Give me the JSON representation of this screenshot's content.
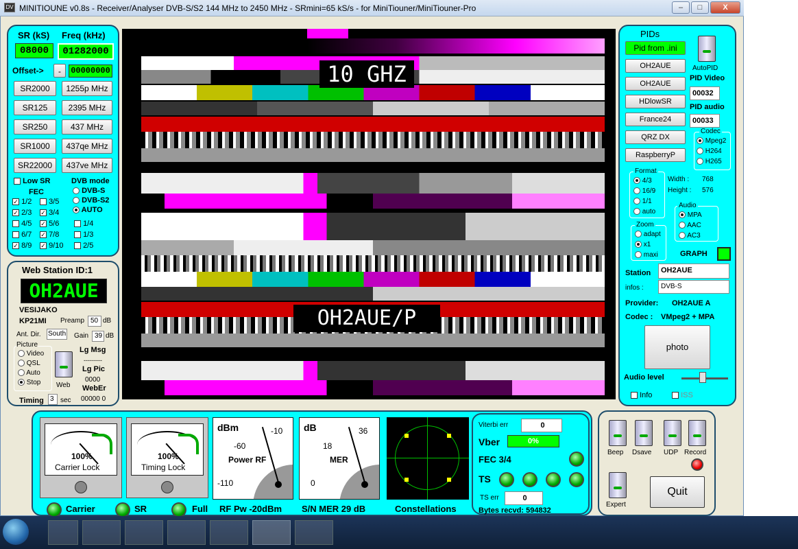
{
  "title": "MINITIOUNE v0.8s - Receiver/Analyser DVB-S/S2 144 MHz to 2450 MHz - SRmini=65 kS/s - for MiniTiouner/MiniTiouner-Pro",
  "colors": {
    "panel": "#00ffff",
    "lcd": "#00ff00",
    "border": "#1e4d6b"
  },
  "left": {
    "sr_label": "SR (kS)",
    "freq_label": "Freq (kHz)",
    "sr": "08000",
    "freq": "01282000",
    "offset_label": "Offset->",
    "offset_sign": "-",
    "offset": "00000000",
    "sr_buttons": [
      "SR2000",
      "SR125",
      "SR250",
      "SR1000",
      "SR22000"
    ],
    "freq_buttons": [
      "1255p MHz",
      "2395 MHz",
      "437 MHz",
      "437qe MHz",
      "437ve MHz"
    ],
    "low_sr": "Low SR",
    "fec_label": "FEC",
    "dvb_label": "DVB mode",
    "dvb_modes": [
      {
        "label": "DVB-S",
        "on": false
      },
      {
        "label": "DVB-S2",
        "on": false
      },
      {
        "label": "AUTO",
        "on": true
      }
    ],
    "fec": [
      [
        {
          "l": "1/2",
          "c": true
        },
        {
          "l": "3/5",
          "c": false
        },
        {
          "l": "",
          "c": null
        }
      ],
      [
        {
          "l": "2/3",
          "c": true
        },
        {
          "l": "3/4",
          "c": true
        },
        {
          "l": "",
          "c": null
        }
      ],
      [
        {
          "l": "4/5",
          "c": false
        },
        {
          "l": "5/6",
          "c": true
        },
        {
          "l": "1/4",
          "c": false
        }
      ],
      [
        {
          "l": "6/7",
          "c": false
        },
        {
          "l": "7/8",
          "c": true
        },
        {
          "l": "1/3",
          "c": false
        }
      ],
      [
        {
          "l": "8/9",
          "c": true
        },
        {
          "l": "9/10",
          "c": true
        },
        {
          "l": "2/5",
          "c": false
        }
      ]
    ]
  },
  "web": {
    "title": "Web Station ID:1",
    "callsign": "OH2AUE",
    "name": "VESIJAKO",
    "locator": "KP21MI",
    "preamp_label": "Preamp",
    "preamp": "50",
    "db": "dB",
    "ant_label": "Ant. Dir.",
    "ant": "South",
    "gain_label": "Gain",
    "gain": "39",
    "picture_label": "Picture",
    "picture_opts": [
      {
        "label": "Video",
        "on": false
      },
      {
        "label": "QSL",
        "on": false
      },
      {
        "label": "Auto",
        "on": false
      },
      {
        "label": "Stop",
        "on": true
      }
    ],
    "web_label": "Web",
    "lgmsg_label": "Lg Msg",
    "lgmsg": "---------",
    "lgpic_label": "Lg Pic",
    "lgpic": "0000",
    "weber_label": "WebEr",
    "weber": "00000  0",
    "timing_label": "Timing",
    "timing": "3",
    "sec": "sec"
  },
  "video": {
    "overlay1": "10 GHZ",
    "overlay2": "OH2AUE/P"
  },
  "right": {
    "pids_label": "PIDs",
    "pid_ini": "Pid from .ini",
    "stations": [
      "OH2AUE",
      "OH2AUE",
      "HDlowSR",
      "France24",
      "QRZ DX",
      "RaspberryP"
    ],
    "autopid_label": "AutoPID",
    "pid_video_label": "PID Video",
    "pid_video": "00032",
    "pid_audio_label": "PID audio",
    "pid_audio": "00033",
    "codec_label": "Codec",
    "codecs": [
      {
        "label": "Mpeg2",
        "on": true
      },
      {
        "label": "H264",
        "on": false
      },
      {
        "label": "H265",
        "on": false
      }
    ],
    "format_label": "Format",
    "formats": [
      {
        "label": "4/3",
        "on": true
      },
      {
        "label": "16/9",
        "on": false
      },
      {
        "label": "1/1",
        "on": false
      },
      {
        "label": "auto",
        "on": false
      }
    ],
    "width_label": "Width :",
    "width": "768",
    "height_label": "Height :",
    "height": "576",
    "audio_label": "Audio",
    "audios": [
      {
        "label": "MPA",
        "on": true
      },
      {
        "label": "AAC",
        "on": false
      },
      {
        "label": "AC3",
        "on": false
      }
    ],
    "zoom_label": "Zoom",
    "zooms": [
      {
        "label": "adapt",
        "on": false
      },
      {
        "label": "x1",
        "on": true
      },
      {
        "label": "maxi",
        "on": false
      }
    ],
    "graph_label": "GRAPH",
    "station_label": "Station",
    "station": "OH2AUE",
    "infos_label": "infos :",
    "infos": "DVB-S",
    "provider_label": "Provider:",
    "provider": "OH2AUE A",
    "codec_info_label": "Codec :",
    "codec_info": "VMpeg2 + MPA",
    "photo": "photo",
    "audio_level_label": "Audio level",
    "audio_level": 0.45,
    "info": "Info",
    "iss": "ISS"
  },
  "bottom": {
    "carrier_pct": "100%",
    "carrier_lock": "Carrier Lock",
    "timing_pct": "100%",
    "timing_lock": "Timing Lock",
    "dbm_label": "dBm",
    "power_rf": "Power RF",
    "dbm_ticks": [
      "-10",
      "-60",
      "-110"
    ],
    "db_label": "dB",
    "mer_label": "MER",
    "db_ticks": [
      "36",
      "18",
      "0"
    ],
    "carrier": "Carrier",
    "sr": "SR",
    "full": "Full",
    "rf_pw": "RF Pw  -20dBm",
    "snmer": "S/N MER   29 dB",
    "constellations": "Constellations",
    "viterbi_label": "Viterbi err",
    "viterbi": "0",
    "vber_label": "Vber",
    "vber": "0%",
    "fec": "FEC 3/4",
    "ts_label": "TS",
    "ts_err_label": "TS err",
    "ts_err": "0",
    "bytes": "Bytes recvd:  594832"
  },
  "controls": {
    "beep": "Beep",
    "dsave": "Dsave",
    "udp": "UDP",
    "record": "Record",
    "expert": "Expert",
    "quit": "Quit"
  },
  "window": {
    "min": "–",
    "max": "□",
    "close": "X"
  }
}
